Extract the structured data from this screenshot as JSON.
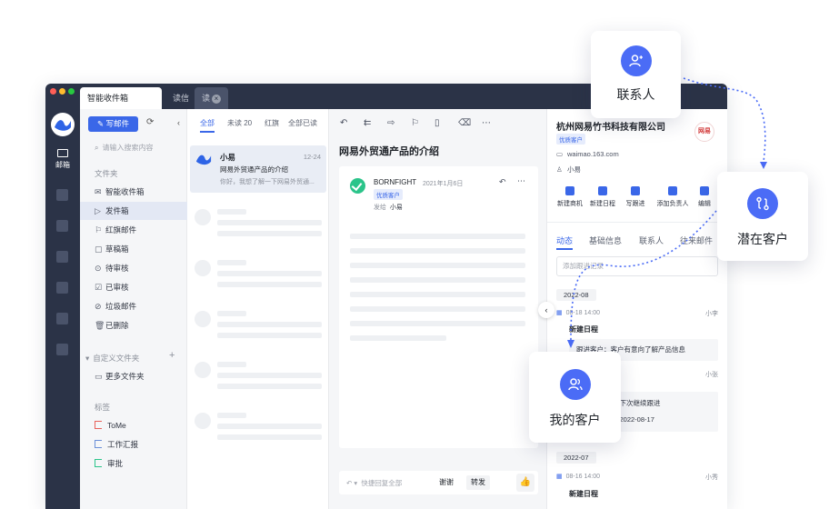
{
  "window": {
    "tabs": [
      {
        "label": "智能收件箱",
        "active": true
      },
      {
        "label": "读信",
        "active": false
      },
      {
        "label": "读",
        "active": false,
        "closable": true
      }
    ]
  },
  "rail": {
    "mail_label": "邮箱"
  },
  "sidebar": {
    "compose_label": "写邮件",
    "search_placeholder": "请输入搜索内容",
    "folders_section": "文件夹",
    "folders": [
      {
        "icon": "inbox-icon",
        "label": "智能收件箱"
      },
      {
        "icon": "send-icon",
        "label": "发件箱",
        "active": true
      },
      {
        "icon": "flag-icon",
        "label": "红旗邮件"
      },
      {
        "icon": "draft-icon",
        "label": "草稿箱"
      },
      {
        "icon": "pending-icon",
        "label": "待审核"
      },
      {
        "icon": "approved-icon",
        "label": "已审核"
      },
      {
        "icon": "trash-icon",
        "label": "垃圾邮件"
      },
      {
        "icon": "delete-icon",
        "label": "已删除"
      }
    ],
    "custom_section": "自定义文件夹",
    "more_folders": "更多文件夹",
    "tags_section": "标签",
    "tags": [
      {
        "label": "ToMe",
        "color": "#e8605a"
      },
      {
        "label": "工作汇报",
        "color": "#6b8fd8"
      },
      {
        "label": "审批",
        "color": "#2bc48a"
      }
    ]
  },
  "msglist": {
    "tabs": [
      "全部",
      "未读 20",
      "红旗",
      "全部已读"
    ],
    "selected_message": {
      "sender": "小易",
      "date": "12-24",
      "subject": "网易外贸通产品的介绍",
      "preview": "你好，我想了解一下网易外贸通..."
    }
  },
  "reading": {
    "title": "网易外贸通产品的介绍",
    "sender_name": "BORNFIGHT",
    "sender_date": "2021年1月6日",
    "sender_badge": "优质客户",
    "sent_to_label": "发给",
    "sent_to": "小易",
    "reply_placeholder": "快捷回复全部",
    "thanks_label": "谢谢",
    "forward_label": "转发"
  },
  "customer": {
    "company": "杭州网易竹书科技有限公司",
    "badge": "优质客户",
    "logo_text": "网易",
    "email": "waimao.163.com",
    "contact": "小易",
    "actions": [
      "新建商机",
      "新建日程",
      "写跟进",
      "添加负责人",
      "编辑"
    ],
    "tabs": [
      "动态",
      "基础信息",
      "联系人",
      "往来邮件"
    ],
    "followup_placeholder": "添加跟进记录",
    "groups": [
      {
        "month": "2022-08",
        "events": [
          {
            "time": "08-18 14:00",
            "owner": "小李",
            "title": "新建日程",
            "detail": "跟进客户：客户有意向了解产品信息"
          },
          {
            "time": "",
            "owner": "小张",
            "title": "",
            "detail": "",
            "partial": [
              "，下次继续跟进",
              "：2022-08-17"
            ]
          }
        ]
      },
      {
        "month": "2022-07",
        "events": [
          {
            "time": "08-16 14:00",
            "owner": "小秀",
            "title": "新建日程",
            "detail": ""
          }
        ]
      }
    ]
  },
  "callouts": {
    "contacts": "联系人",
    "prospects": "潜在客户",
    "my_customers": "我的客户"
  },
  "colors": {
    "accent": "#3a67e8",
    "callout_icon": "#4b6cf6",
    "dark_chrome": "#2b3347"
  }
}
